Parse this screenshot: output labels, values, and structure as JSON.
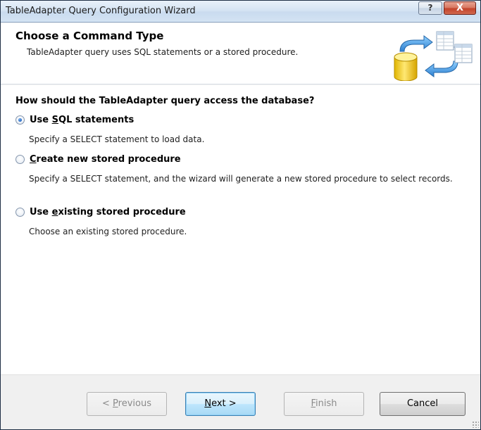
{
  "window": {
    "title": "TableAdapter Query Configuration Wizard",
    "help_glyph": "?",
    "close_glyph": "X"
  },
  "header": {
    "title": "Choose a Command Type",
    "description": "TableAdapter query uses SQL statements or a stored procedure.",
    "art_icon": "database-tables-icon"
  },
  "question": "How should the TableAdapter query access the database?",
  "options": [
    {
      "label_pre": "Use ",
      "label_key": "S",
      "label_post": "QL statements",
      "description": "Specify a SELECT statement to load data.",
      "checked": true
    },
    {
      "label_pre": "",
      "label_key": "C",
      "label_post": "reate new stored procedure",
      "description": "Specify a SELECT statement, and the wizard will generate a new stored procedure to select records.",
      "checked": false
    },
    {
      "label_pre": "Use ",
      "label_key": "e",
      "label_post": "xisting stored procedure",
      "description": "Choose an existing stored procedure.",
      "checked": false
    }
  ],
  "buttons": {
    "previous": {
      "pre": "< ",
      "key": "P",
      "post": "revious",
      "enabled": false
    },
    "next": {
      "pre": "",
      "key": "N",
      "post": "ext >",
      "enabled": true
    },
    "finish": {
      "pre": "",
      "key": "F",
      "post": "inish",
      "enabled": false
    },
    "cancel": {
      "label": "Cancel",
      "enabled": true
    }
  },
  "colors": {
    "accent": "#3c7fb1",
    "radio_checked": "#2a6cc8",
    "close_button": "#c3432b"
  }
}
